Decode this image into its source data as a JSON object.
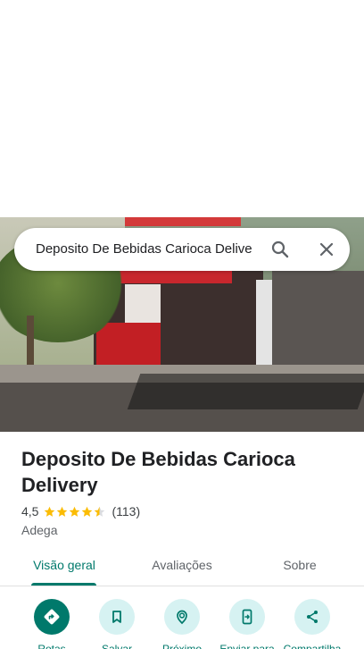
{
  "search": {
    "query": "Deposito De Bebidas Carioca Delive"
  },
  "place": {
    "name": "Deposito De Bebidas Carioca Delivery",
    "rating": "4,5",
    "stars_value": 4.5,
    "stars_max": 5,
    "review_count": "(113)",
    "category": "Adega"
  },
  "tabs": [
    {
      "label": "Visão geral",
      "active": true
    },
    {
      "label": "Avaliações",
      "active": false
    },
    {
      "label": "Sobre",
      "active": false
    }
  ],
  "actions": [
    {
      "label": "Rotas",
      "icon": "directions-icon"
    },
    {
      "label": "Salvar",
      "icon": "bookmark-icon"
    },
    {
      "label": "Próximo",
      "icon": "nearby-icon"
    },
    {
      "label": "Enviar para",
      "icon": "send-to-phone-icon"
    },
    {
      "label": "Compartilha",
      "icon": "share-icon"
    }
  ],
  "colors": {
    "accent": "#00796b",
    "action_bg": "#d6f2f2",
    "star": "#fbbc04"
  }
}
